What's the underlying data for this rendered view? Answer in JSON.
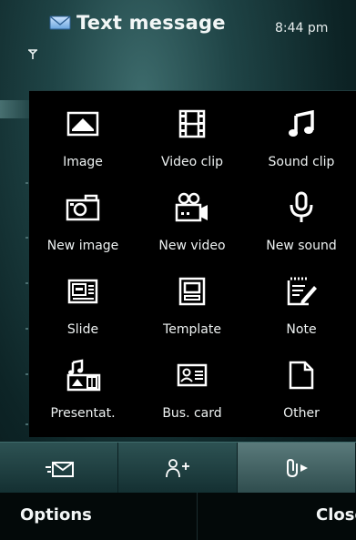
{
  "status": {
    "title": "Text message",
    "time": "8:44 pm",
    "icons": [
      "mail-icon",
      "signal-icon"
    ]
  },
  "insert_menu": {
    "items": [
      {
        "label": "Image",
        "icon": "image-icon"
      },
      {
        "label": "Video clip",
        "icon": "film-icon"
      },
      {
        "label": "Sound clip",
        "icon": "music-note-icon"
      },
      {
        "label": "New image",
        "icon": "camera-icon"
      },
      {
        "label": "New video",
        "icon": "video-camera-icon"
      },
      {
        "label": "New sound",
        "icon": "microphone-icon"
      },
      {
        "label": "Slide",
        "icon": "slide-icon"
      },
      {
        "label": "Template",
        "icon": "template-icon"
      },
      {
        "label": "Note",
        "icon": "note-icon"
      },
      {
        "label": "Presentat.",
        "icon": "presentation-icon"
      },
      {
        "label": "Bus. card",
        "icon": "business-card-icon"
      },
      {
        "label": "Other",
        "icon": "blank-document-icon"
      }
    ]
  },
  "tabs": [
    {
      "icon": "send-message-icon"
    },
    {
      "icon": "add-recipient-icon"
    },
    {
      "icon": "attach-icon",
      "active": true
    }
  ],
  "softkeys": {
    "left": "Options",
    "right": "Close"
  },
  "colors": {
    "panel_bg": "#000000",
    "tab_active": "#5a7a7b",
    "text": "#ffffff"
  }
}
